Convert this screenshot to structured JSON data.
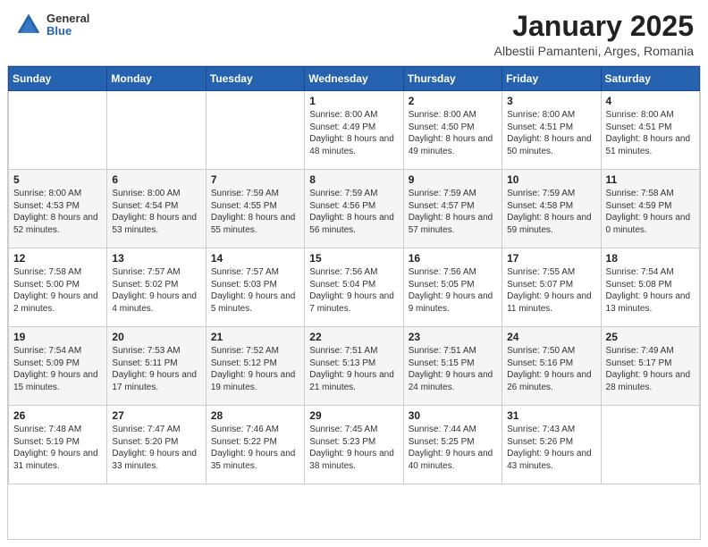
{
  "logo": {
    "general": "General",
    "blue": "Blue"
  },
  "header": {
    "month": "January 2025",
    "location": "Albestii Pamanteni, Arges, Romania"
  },
  "weekdays": [
    "Sunday",
    "Monday",
    "Tuesday",
    "Wednesday",
    "Thursday",
    "Friday",
    "Saturday"
  ],
  "weeks": [
    [
      {
        "day": "",
        "sunrise": "",
        "sunset": "",
        "daylight": ""
      },
      {
        "day": "",
        "sunrise": "",
        "sunset": "",
        "daylight": ""
      },
      {
        "day": "",
        "sunrise": "",
        "sunset": "",
        "daylight": ""
      },
      {
        "day": "1",
        "sunrise": "Sunrise: 8:00 AM",
        "sunset": "Sunset: 4:49 PM",
        "daylight": "Daylight: 8 hours and 48 minutes."
      },
      {
        "day": "2",
        "sunrise": "Sunrise: 8:00 AM",
        "sunset": "Sunset: 4:50 PM",
        "daylight": "Daylight: 8 hours and 49 minutes."
      },
      {
        "day": "3",
        "sunrise": "Sunrise: 8:00 AM",
        "sunset": "Sunset: 4:51 PM",
        "daylight": "Daylight: 8 hours and 50 minutes."
      },
      {
        "day": "4",
        "sunrise": "Sunrise: 8:00 AM",
        "sunset": "Sunset: 4:51 PM",
        "daylight": "Daylight: 8 hours and 51 minutes."
      }
    ],
    [
      {
        "day": "5",
        "sunrise": "Sunrise: 8:00 AM",
        "sunset": "Sunset: 4:53 PM",
        "daylight": "Daylight: 8 hours and 52 minutes."
      },
      {
        "day": "6",
        "sunrise": "Sunrise: 8:00 AM",
        "sunset": "Sunset: 4:54 PM",
        "daylight": "Daylight: 8 hours and 53 minutes."
      },
      {
        "day": "7",
        "sunrise": "Sunrise: 7:59 AM",
        "sunset": "Sunset: 4:55 PM",
        "daylight": "Daylight: 8 hours and 55 minutes."
      },
      {
        "day": "8",
        "sunrise": "Sunrise: 7:59 AM",
        "sunset": "Sunset: 4:56 PM",
        "daylight": "Daylight: 8 hours and 56 minutes."
      },
      {
        "day": "9",
        "sunrise": "Sunrise: 7:59 AM",
        "sunset": "Sunset: 4:57 PM",
        "daylight": "Daylight: 8 hours and 57 minutes."
      },
      {
        "day": "10",
        "sunrise": "Sunrise: 7:59 AM",
        "sunset": "Sunset: 4:58 PM",
        "daylight": "Daylight: 8 hours and 59 minutes."
      },
      {
        "day": "11",
        "sunrise": "Sunrise: 7:58 AM",
        "sunset": "Sunset: 4:59 PM",
        "daylight": "Daylight: 9 hours and 0 minutes."
      }
    ],
    [
      {
        "day": "12",
        "sunrise": "Sunrise: 7:58 AM",
        "sunset": "Sunset: 5:00 PM",
        "daylight": "Daylight: 9 hours and 2 minutes."
      },
      {
        "day": "13",
        "sunrise": "Sunrise: 7:57 AM",
        "sunset": "Sunset: 5:02 PM",
        "daylight": "Daylight: 9 hours and 4 minutes."
      },
      {
        "day": "14",
        "sunrise": "Sunrise: 7:57 AM",
        "sunset": "Sunset: 5:03 PM",
        "daylight": "Daylight: 9 hours and 5 minutes."
      },
      {
        "day": "15",
        "sunrise": "Sunrise: 7:56 AM",
        "sunset": "Sunset: 5:04 PM",
        "daylight": "Daylight: 9 hours and 7 minutes."
      },
      {
        "day": "16",
        "sunrise": "Sunrise: 7:56 AM",
        "sunset": "Sunset: 5:05 PM",
        "daylight": "Daylight: 9 hours and 9 minutes."
      },
      {
        "day": "17",
        "sunrise": "Sunrise: 7:55 AM",
        "sunset": "Sunset: 5:07 PM",
        "daylight": "Daylight: 9 hours and 11 minutes."
      },
      {
        "day": "18",
        "sunrise": "Sunrise: 7:54 AM",
        "sunset": "Sunset: 5:08 PM",
        "daylight": "Daylight: 9 hours and 13 minutes."
      }
    ],
    [
      {
        "day": "19",
        "sunrise": "Sunrise: 7:54 AM",
        "sunset": "Sunset: 5:09 PM",
        "daylight": "Daylight: 9 hours and 15 minutes."
      },
      {
        "day": "20",
        "sunrise": "Sunrise: 7:53 AM",
        "sunset": "Sunset: 5:11 PM",
        "daylight": "Daylight: 9 hours and 17 minutes."
      },
      {
        "day": "21",
        "sunrise": "Sunrise: 7:52 AM",
        "sunset": "Sunset: 5:12 PM",
        "daylight": "Daylight: 9 hours and 19 minutes."
      },
      {
        "day": "22",
        "sunrise": "Sunrise: 7:51 AM",
        "sunset": "Sunset: 5:13 PM",
        "daylight": "Daylight: 9 hours and 21 minutes."
      },
      {
        "day": "23",
        "sunrise": "Sunrise: 7:51 AM",
        "sunset": "Sunset: 5:15 PM",
        "daylight": "Daylight: 9 hours and 24 minutes."
      },
      {
        "day": "24",
        "sunrise": "Sunrise: 7:50 AM",
        "sunset": "Sunset: 5:16 PM",
        "daylight": "Daylight: 9 hours and 26 minutes."
      },
      {
        "day": "25",
        "sunrise": "Sunrise: 7:49 AM",
        "sunset": "Sunset: 5:17 PM",
        "daylight": "Daylight: 9 hours and 28 minutes."
      }
    ],
    [
      {
        "day": "26",
        "sunrise": "Sunrise: 7:48 AM",
        "sunset": "Sunset: 5:19 PM",
        "daylight": "Daylight: 9 hours and 31 minutes."
      },
      {
        "day": "27",
        "sunrise": "Sunrise: 7:47 AM",
        "sunset": "Sunset: 5:20 PM",
        "daylight": "Daylight: 9 hours and 33 minutes."
      },
      {
        "day": "28",
        "sunrise": "Sunrise: 7:46 AM",
        "sunset": "Sunset: 5:22 PM",
        "daylight": "Daylight: 9 hours and 35 minutes."
      },
      {
        "day": "29",
        "sunrise": "Sunrise: 7:45 AM",
        "sunset": "Sunset: 5:23 PM",
        "daylight": "Daylight: 9 hours and 38 minutes."
      },
      {
        "day": "30",
        "sunrise": "Sunrise: 7:44 AM",
        "sunset": "Sunset: 5:25 PM",
        "daylight": "Daylight: 9 hours and 40 minutes."
      },
      {
        "day": "31",
        "sunrise": "Sunrise: 7:43 AM",
        "sunset": "Sunset: 5:26 PM",
        "daylight": "Daylight: 9 hours and 43 minutes."
      },
      {
        "day": "",
        "sunrise": "",
        "sunset": "",
        "daylight": ""
      }
    ]
  ]
}
